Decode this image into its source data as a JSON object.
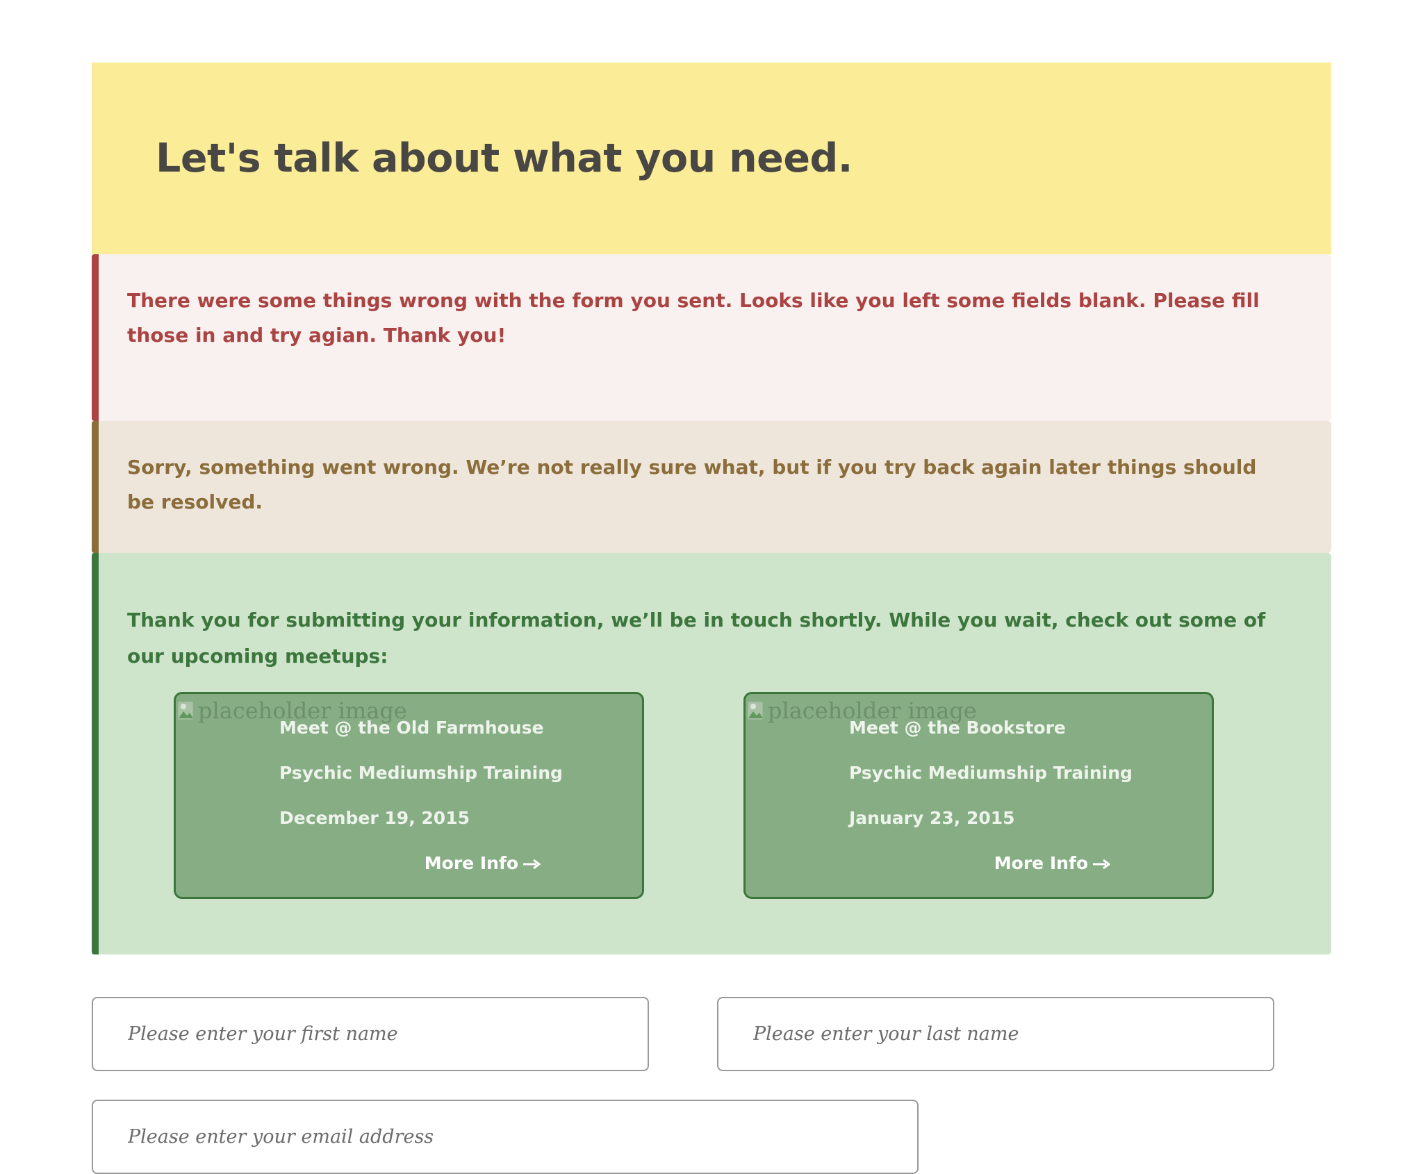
{
  "hero": {
    "title": "Let's talk about what you need."
  },
  "alerts": {
    "error": "There were some things wrong with the form you sent. Looks like you left some fields blank. Please fill those in and try agian. Thank you!",
    "warning": "Sorry, something went wrong. We’re not really sure what, but if you try back again later things should be resolved.",
    "success": "Thank you for submitting your information, we’ll be in touch shortly. While you wait, check out some of our upcoming meetups:"
  },
  "meetups": [
    {
      "image_alt": "placeholder image",
      "location": "Meet @ the Old Farmhouse",
      "event": "Psychic Mediumship Training",
      "date": "December 19, 2015",
      "link_label": "More Info"
    },
    {
      "image_alt": "placeholder image",
      "location": "Meet @ the Bookstore",
      "event": "Psychic Mediumship Training",
      "date": "January 23, 2015",
      "link_label": "More Info"
    }
  ],
  "form": {
    "first_name_placeholder": "Please enter your first name",
    "last_name_placeholder": "Please enter your last name",
    "email_placeholder": "Please enter your email address"
  },
  "colors": {
    "hero_bg": "#fbed98",
    "error": "#a94442",
    "warning": "#8a6d3b",
    "success": "#3c763d",
    "card_bg": "#86ad84"
  },
  "icons": {
    "more_info": "arrow-right-icon",
    "broken_image": "broken-image-icon"
  }
}
